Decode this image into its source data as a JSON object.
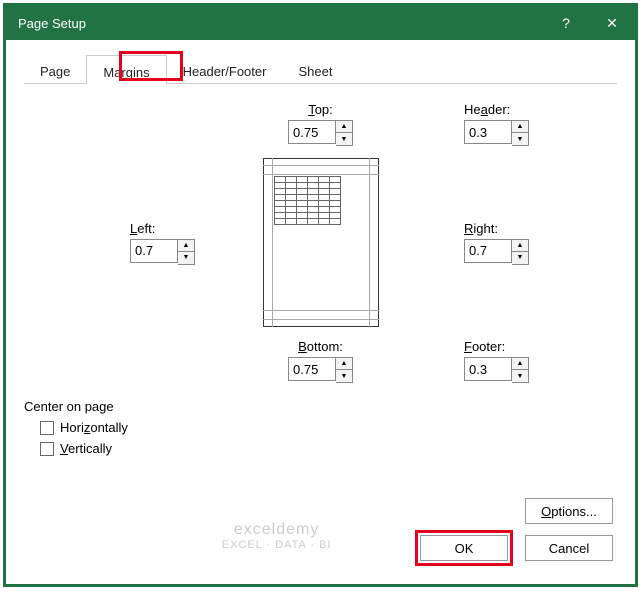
{
  "titlebar": {
    "title": "Page Setup",
    "help": "?",
    "close": "✕"
  },
  "tabs": {
    "page": "Page",
    "margins": "Margins",
    "header_footer": "Header/Footer",
    "sheet": "Sheet"
  },
  "margins": {
    "top_label": "Top:",
    "top_value": "0.75",
    "header_label": "Header:",
    "header_value": "0.3",
    "left_label": "Left:",
    "left_value": "0.7",
    "right_label": "Right:",
    "right_value": "0.7",
    "bottom_label": "Bottom:",
    "bottom_value": "0.75",
    "footer_label": "Footer:",
    "footer_value": "0.3"
  },
  "center": {
    "group": "Center on page",
    "horizontally": "Horizontally",
    "vertically": "Vertically"
  },
  "buttons": {
    "options": "Options...",
    "ok": "OK",
    "cancel": "Cancel"
  },
  "watermark": {
    "line1": "exceldemy",
    "line2": "EXCEL · DATA · BI"
  }
}
